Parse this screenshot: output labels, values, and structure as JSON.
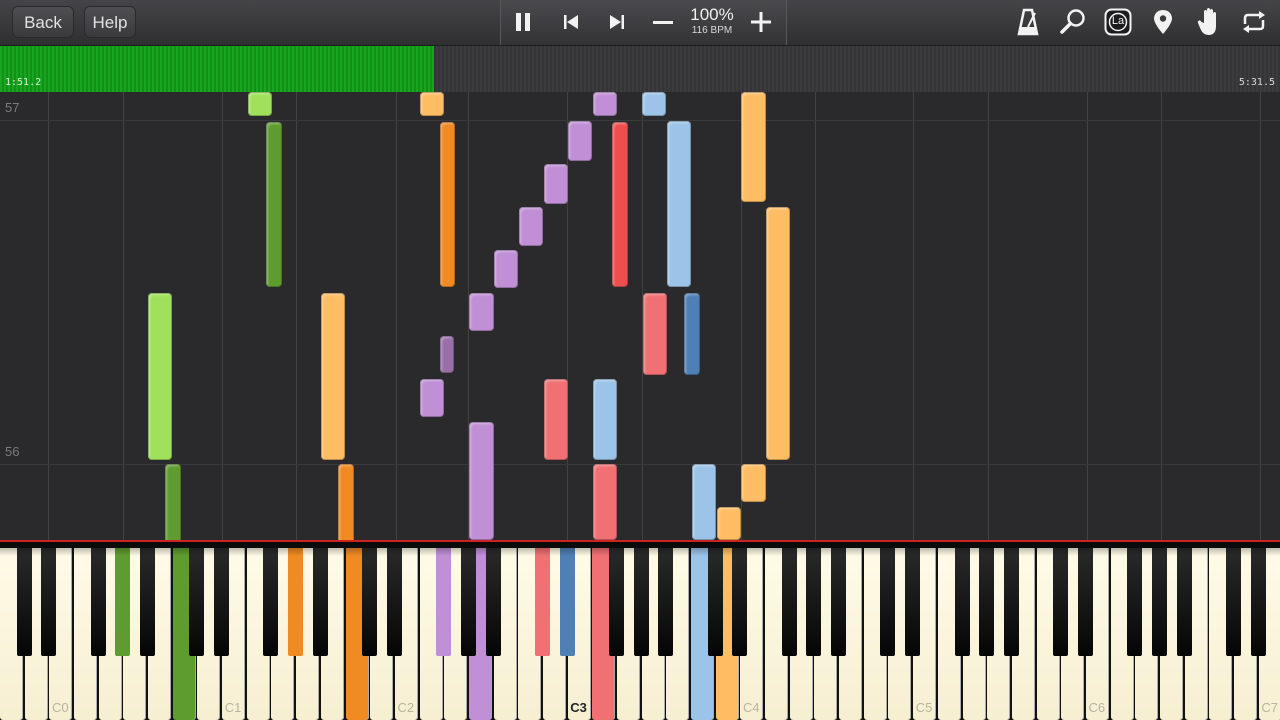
{
  "toolbar": {
    "back_label": "Back",
    "help_label": "Help",
    "speed_percent": "100%",
    "speed_bpm": "116 BPM",
    "icons": [
      "pause-icon",
      "skip-back-icon",
      "skip-forward-icon",
      "minus-icon",
      "plus-icon",
      "metronome-icon",
      "magnifier-icon",
      "note-label-icon",
      "location-pin-icon",
      "hand-icon",
      "loop-icon"
    ],
    "note_label_text": "La"
  },
  "timeline": {
    "current_time": "1:51.2",
    "total_time": "5:31.5",
    "progress_fraction": 0.339
  },
  "roll": {
    "measures": [
      "57",
      "56"
    ]
  },
  "keyboard": {
    "octave_labels": [
      "C0",
      "C1",
      "C2",
      "C3",
      "C4",
      "C5",
      "C6",
      "C7"
    ]
  },
  "colors": {
    "green_light": "#9fe15a",
    "green_dark": "#5f9c2f",
    "orange_light": "#ffbd63",
    "orange_dark": "#f08a22",
    "purple": "#c08fd6",
    "red": "#f07073",
    "blue_light": "#9cc4e8",
    "blue_dark": "#4e7fb5",
    "progress_green": "#19a51f"
  }
}
